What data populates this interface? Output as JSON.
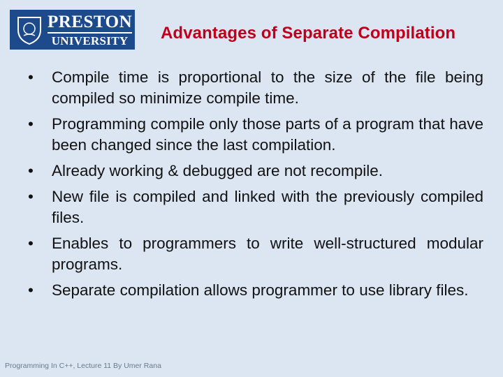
{
  "logo": {
    "line1": "PRESTON",
    "line2": "UNIVERSITY"
  },
  "title": "Advantages of Separate Compilation",
  "bullets": [
    "Compile time is proportional to the size of the file being compiled so minimize compile time.",
    "Programming compile only those parts of a program that have been changed since the last compilation.",
    "Already working & debugged are not recompile.",
    "New file is compiled and linked with the previously compiled files.",
    "Enables to programmers to write well-structured modular programs.",
    "Separate compilation allows programmer to use library files."
  ],
  "bullet_glyph": "•",
  "footer": "Programming In C++, Lecture 11 By Umer  Rana",
  "colors": {
    "background": "#dce6f2",
    "title": "#c0001a",
    "logo_bg": "#1d4a8a"
  }
}
